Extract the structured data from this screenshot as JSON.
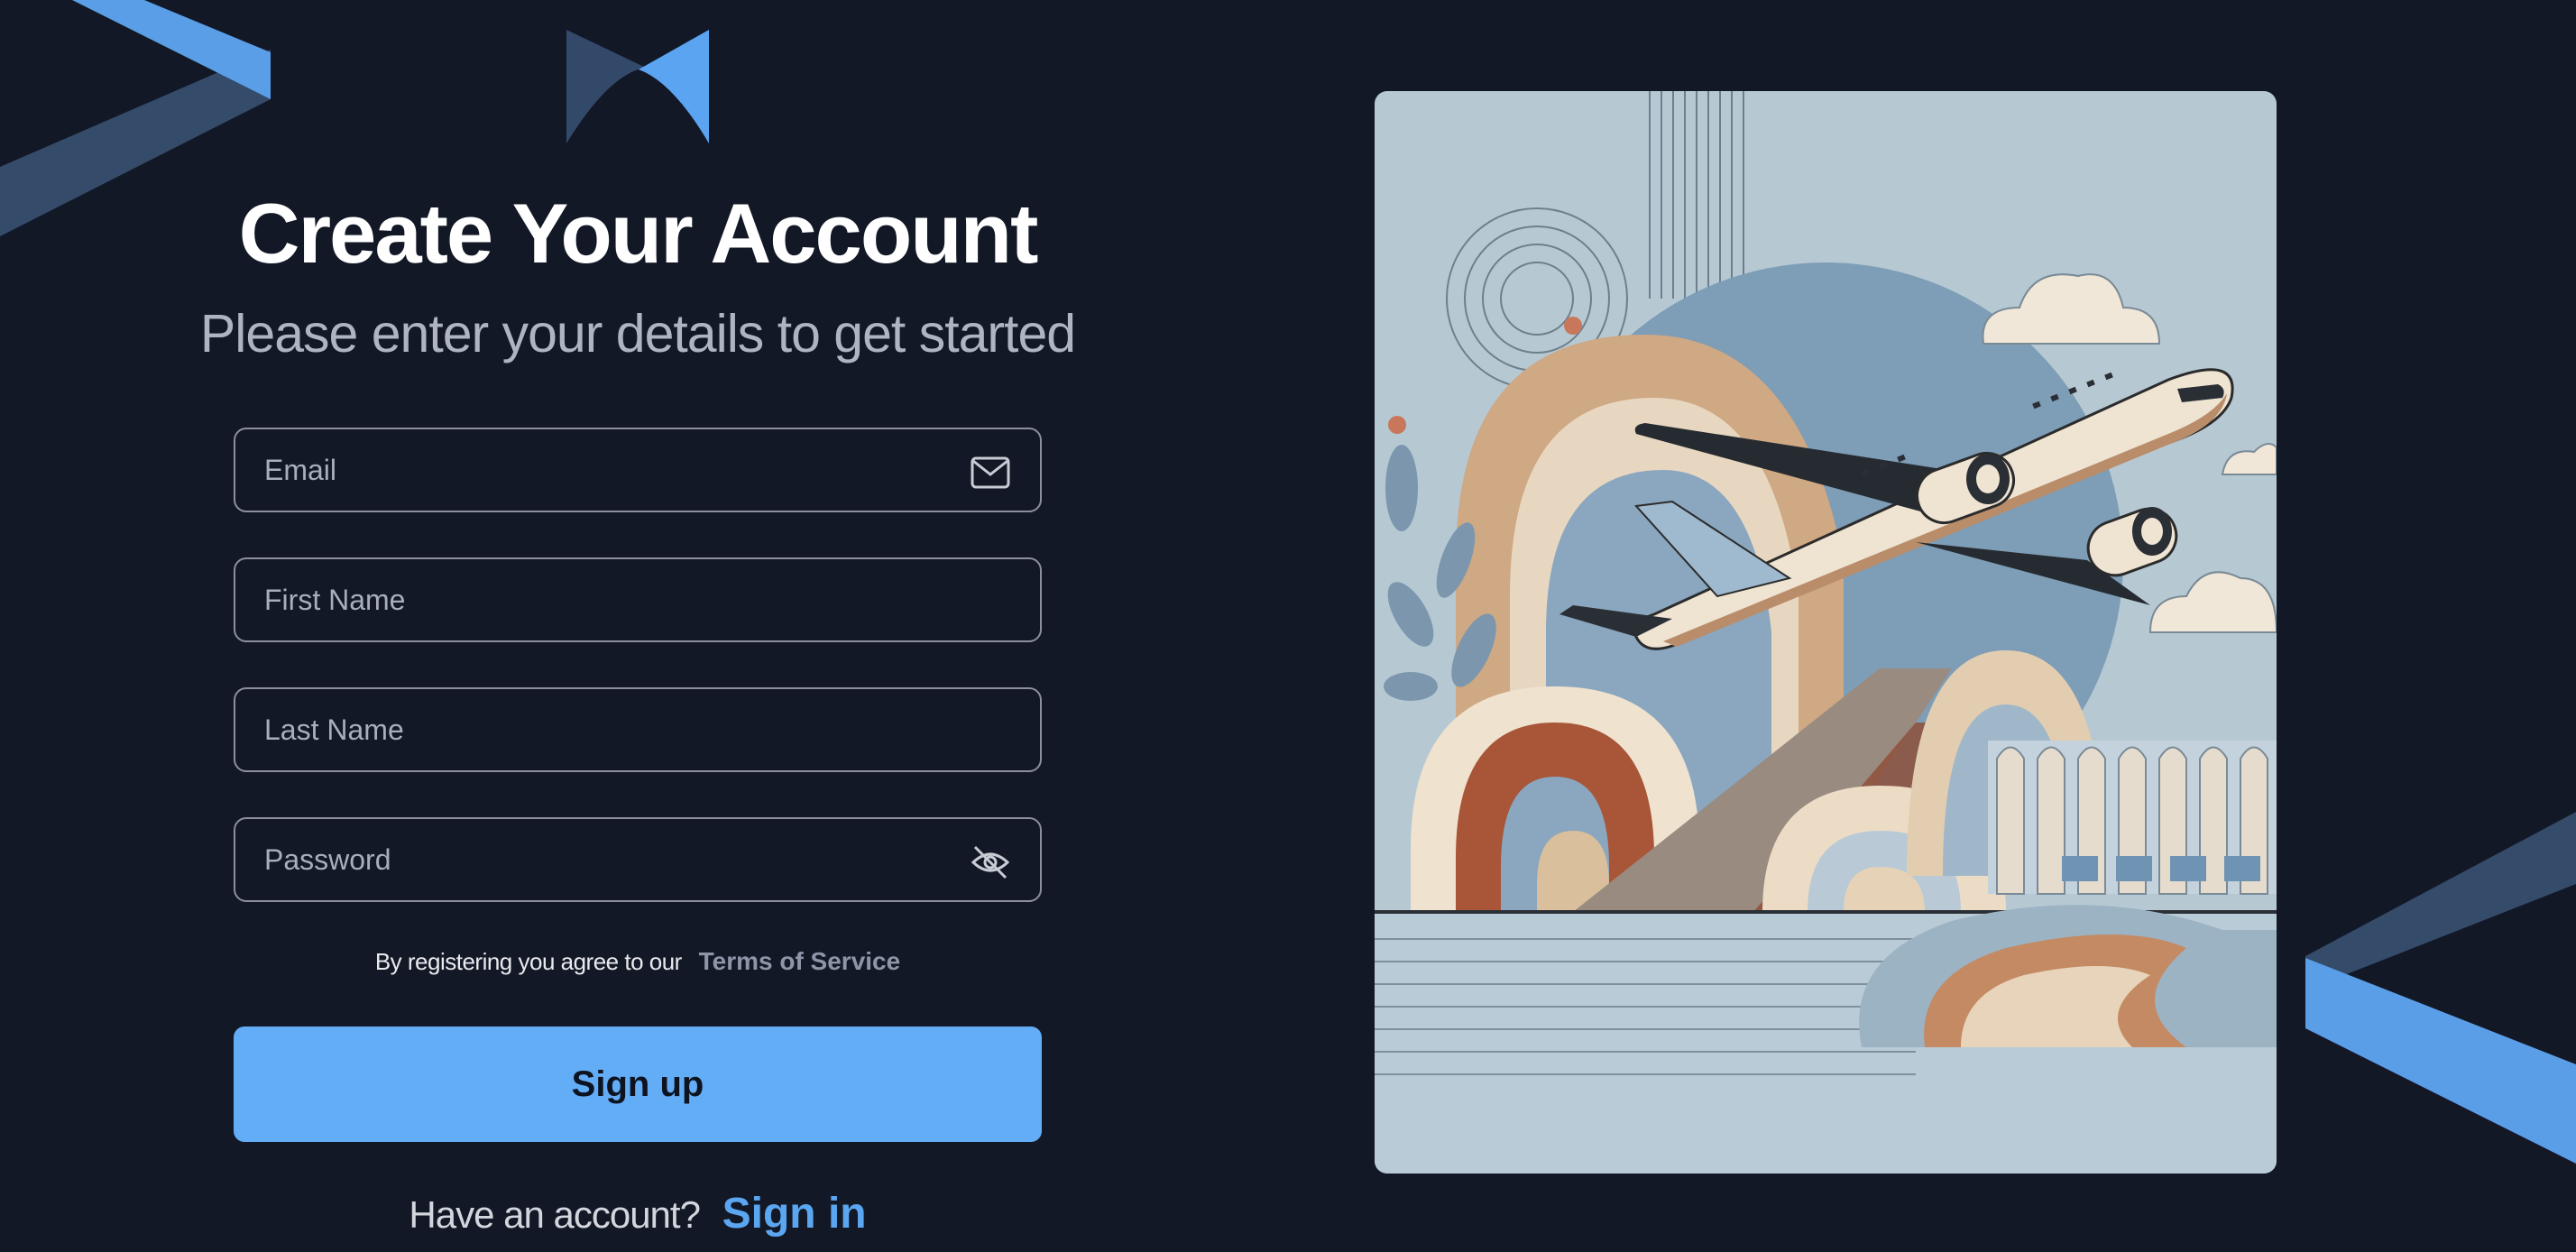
{
  "brand": {
    "logo_icon": "bowtie-logo-icon",
    "accent": "#63adf7"
  },
  "header": {
    "title": "Create Your Account",
    "subtitle": "Please enter your details to get started"
  },
  "form": {
    "email": {
      "placeholder": "Email",
      "value": "",
      "icon": "mail-icon"
    },
    "first_name": {
      "placeholder": "First Name",
      "value": ""
    },
    "last_name": {
      "placeholder": "Last Name",
      "value": ""
    },
    "password": {
      "placeholder": "Password",
      "value": "",
      "icon": "eye-off-icon"
    }
  },
  "terms": {
    "text": "By registering you agree to our",
    "link": "Terms of Service"
  },
  "signup_button": {
    "label": "Sign up"
  },
  "signin": {
    "prompt": "Have an account?",
    "link": "Sign in"
  },
  "illustration": {
    "subject": "airplane-illustration"
  }
}
